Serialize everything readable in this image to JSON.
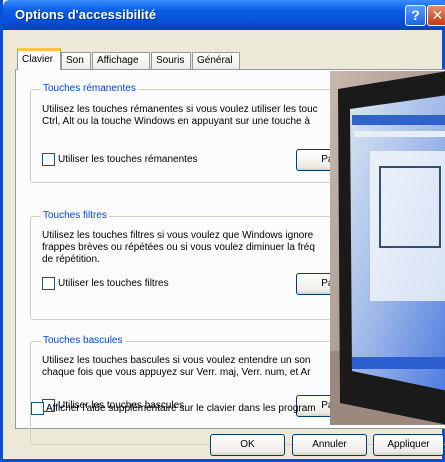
{
  "window": {
    "title": "Options d'accessibilité",
    "help_glyph": "?",
    "close_glyph": "✕"
  },
  "tabs": [
    {
      "label": "Clavier",
      "active": true
    },
    {
      "label": "Son"
    },
    {
      "label": "Affichage"
    },
    {
      "label": "Souris"
    },
    {
      "label": "Général"
    }
  ],
  "groups": {
    "sticky": {
      "title": "Touches rémanentes",
      "desc1": "Utilisez les touches rémanentes si vous voulez utiliser les touc",
      "desc2": "Ctrl, Alt ou la touche Windows en appuyant sur une touche à",
      "checkbox": "Utiliser les touches rémanentes",
      "button": "Param"
    },
    "filter": {
      "title": "Touches filtres",
      "desc1": "Utilisez les touches filtres si vous voulez que Windows ignore",
      "desc2": "frappes brèves ou répétées ou si vous voulez diminuer la fréq",
      "desc3": "de répétition.",
      "checkbox": "Utiliser les touches filtres",
      "button": "Param"
    },
    "toggle": {
      "title": "Touches bascules",
      "desc1": "Utilisez les touches bascules si vous voulez entendre un son",
      "desc2": "chaque fois que vous appuyez sur Verr. maj, Verr. num, et Ar",
      "checkbox": "Utiliser les touches bascules",
      "button": "Param"
    }
  },
  "extra_checkbox": "Afficher l'aide supplémentaire sur le clavier dans les program",
  "buttons": {
    "ok": "OK",
    "cancel": "Annuler",
    "apply": "Appliquer"
  },
  "colors": {
    "title_bar": "#0a5ee6",
    "group_title": "#0046d5",
    "dialog_bg": "#ece9d8"
  }
}
